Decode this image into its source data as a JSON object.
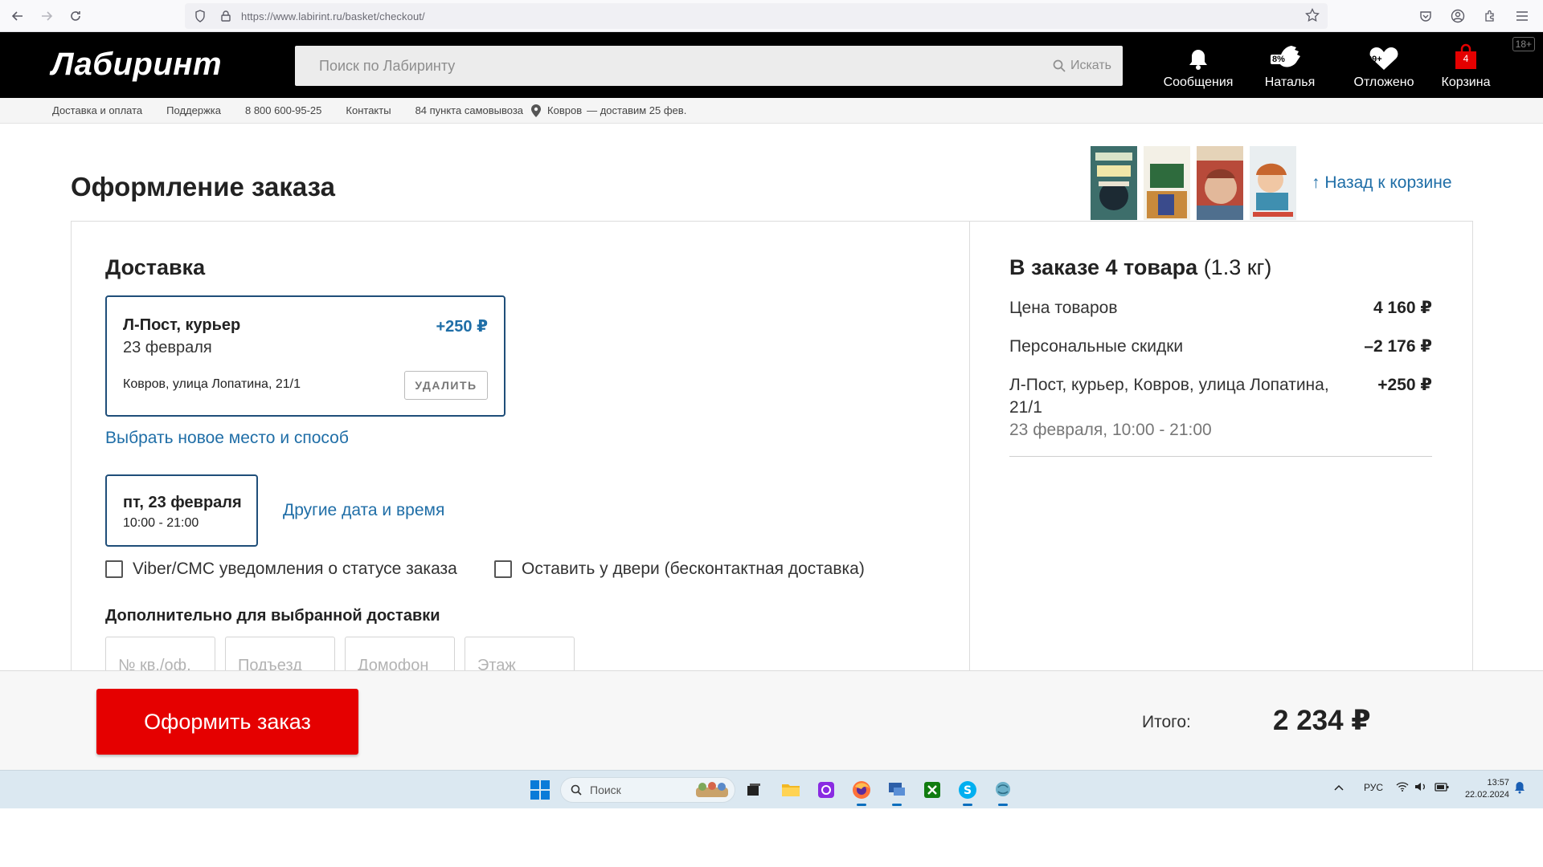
{
  "browser": {
    "url": "https://www.labirint.ru/basket/checkout/"
  },
  "header": {
    "logo": "Лабиринт",
    "search_placeholder": "Поиск по Лабиринту",
    "search_button": "Искать",
    "messages_label": "Сообщения",
    "profile_label": "Наталья",
    "profile_badge": "8%",
    "deferred_label": "Отложено",
    "deferred_badge": "99+",
    "cart_label": "Корзина",
    "cart_count": "4",
    "age_rating": "18+"
  },
  "subnav": {
    "delivery": "Доставка и оплата",
    "support": "Поддержка",
    "phone": "8 800 600-95-25",
    "contacts": "Контакты",
    "pickup_points": "84 пункта самовывоза",
    "city": "Ковров",
    "delivery_date": "—  доставим 25 фев."
  },
  "page": {
    "title": "Оформление заказа",
    "back_link": "↑ Назад к корзине"
  },
  "delivery": {
    "section_title": "Доставка",
    "method": "Л-Пост, курьер",
    "price": "+250 ₽",
    "date": "23 февраля",
    "address": "Ковров, улица Лопатина, 21/1",
    "delete_button": "УДАЛИТЬ",
    "choose_new": "Выбрать новое место и способ",
    "slot_day": "пт, 23 февраля",
    "slot_time": "10:00 - 21:00",
    "other_dates": "Другие дата и время",
    "viber_notify": "Viber/СМС уведомления о статусе заказа",
    "leave_at_door": "Оставить у двери (бесконтактная доставка)",
    "extra_title": "Дополнительно для выбранной доставки",
    "field_apartment": "№ кв./оф.",
    "field_entrance": "Подъезд",
    "field_intercom": "Домофон",
    "field_floor": "Этаж"
  },
  "summary": {
    "title_bold": "В заказе 4 товара",
    "title_weight": "(1.3 кг)",
    "goods_label": "Цена товаров",
    "goods_value": "4 160 ₽",
    "discount_label": "Персональные скидки",
    "discount_value": "–2 176 ₽",
    "shipping_label": "Л-Пост, курьер, Ковров, улица Лопатина, 21/1",
    "shipping_value": "+250 ₽",
    "shipping_sub": "23 февраля, 10:00 - 21:00"
  },
  "footer": {
    "order_button": "Оформить заказ",
    "total_label": "Итого:",
    "total_value": "2 234 ₽"
  },
  "taskbar": {
    "search_placeholder": "Поиск",
    "language": "РУС",
    "time": "13:57",
    "date": "22.02.2024"
  },
  "colors": {
    "brand_red": "#e50000",
    "link_blue": "#1f6ea7",
    "card_border": "#1f4e79"
  }
}
